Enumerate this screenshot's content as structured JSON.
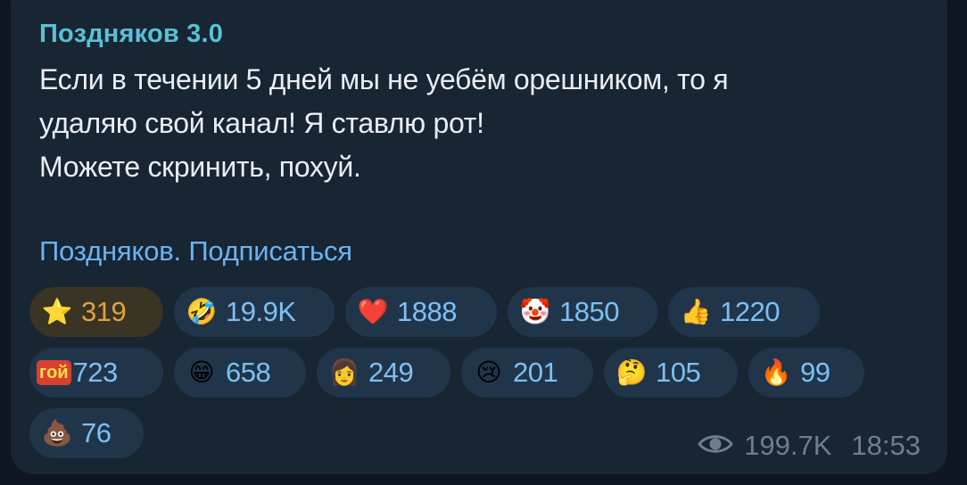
{
  "message": {
    "channel_name": "Поздняков 3.0",
    "lines": [
      "Если в течении 5 дней мы не уебём орешником, то я",
      "удаляю свой канал! Я ставлю рот!",
      "Можете скринить, похуй."
    ],
    "subscribe_link": "Поздняков. Подписаться"
  },
  "reactions": [
    {
      "icon": "star-icon",
      "emoji": "⭐",
      "count": "319"
    },
    {
      "icon": "rofl-face-icon",
      "emoji": "🤣",
      "count": "19.9K"
    },
    {
      "icon": "red-heart-icon",
      "emoji": "❤️",
      "count": "1888"
    },
    {
      "icon": "clown-face-icon",
      "emoji": "🤡",
      "count": "1850"
    },
    {
      "icon": "thumbs-up-icon",
      "emoji": "👍",
      "count": "1220"
    },
    {
      "icon": "goi-custom-emoji-icon",
      "emoji": "гой",
      "count": "723"
    },
    {
      "icon": "grinning-face-icon",
      "emoji": "😁",
      "count": "658"
    },
    {
      "icon": "custom-face-emoji-icon",
      "emoji": "👩",
      "count": "249"
    },
    {
      "icon": "crying-face-icon",
      "emoji": "😢",
      "count": "201"
    },
    {
      "icon": "thinking-face-icon",
      "emoji": "🤔",
      "count": "105"
    },
    {
      "icon": "fire-icon",
      "emoji": "🔥",
      "count": "99"
    },
    {
      "icon": "poo-icon",
      "emoji": "💩",
      "count": "76"
    }
  ],
  "meta": {
    "views": "199.7K",
    "time": "18:53"
  },
  "colors": {
    "background": "#0e1621",
    "bubble": "#182533",
    "link": "#6ab3f3",
    "channel_name": "#59c0d6",
    "star_count": "#e0a23b"
  }
}
